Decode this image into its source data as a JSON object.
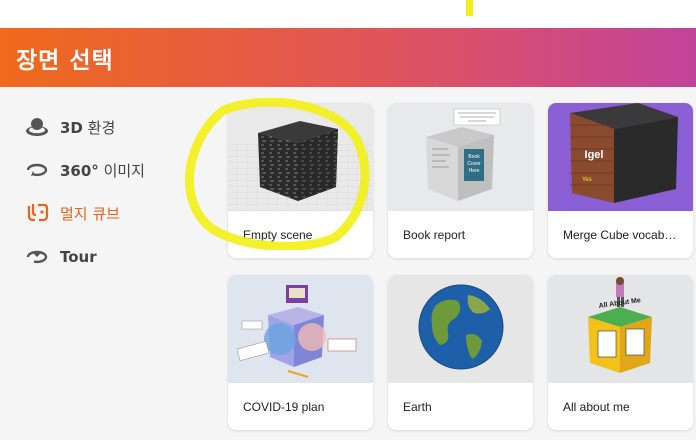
{
  "header": {
    "title": "장면 선택"
  },
  "sidebar": {
    "items": [
      {
        "label_bold": "3D",
        "label_light": " 환경",
        "icon": "3d-environment-icon"
      },
      {
        "label_bold": "360°",
        "label_light": " 이미지",
        "icon": "360-image-icon"
      },
      {
        "label_bold": "",
        "label_light": "멀지 큐브",
        "icon": "merge-cube-icon"
      },
      {
        "label_bold": "Tour",
        "label_light": "",
        "icon": "tour-icon"
      }
    ]
  },
  "cards": [
    {
      "label": "Empty scene"
    },
    {
      "label": "Book report"
    },
    {
      "label": "Merge Cube vocabulary"
    },
    {
      "label": "COVID-19 plan"
    },
    {
      "label": "Earth"
    },
    {
      "label": "All about me"
    }
  ],
  "thumb_text": {
    "book_cover": "Book Cover Here",
    "igel": "Igel",
    "yes": "Yes",
    "all_about_me": "All About Me"
  },
  "colors": {
    "accent": "#e8631d",
    "highlight": "#f2ef1a",
    "header_start": "#ef6a1c",
    "header_end": "#c2439b"
  }
}
